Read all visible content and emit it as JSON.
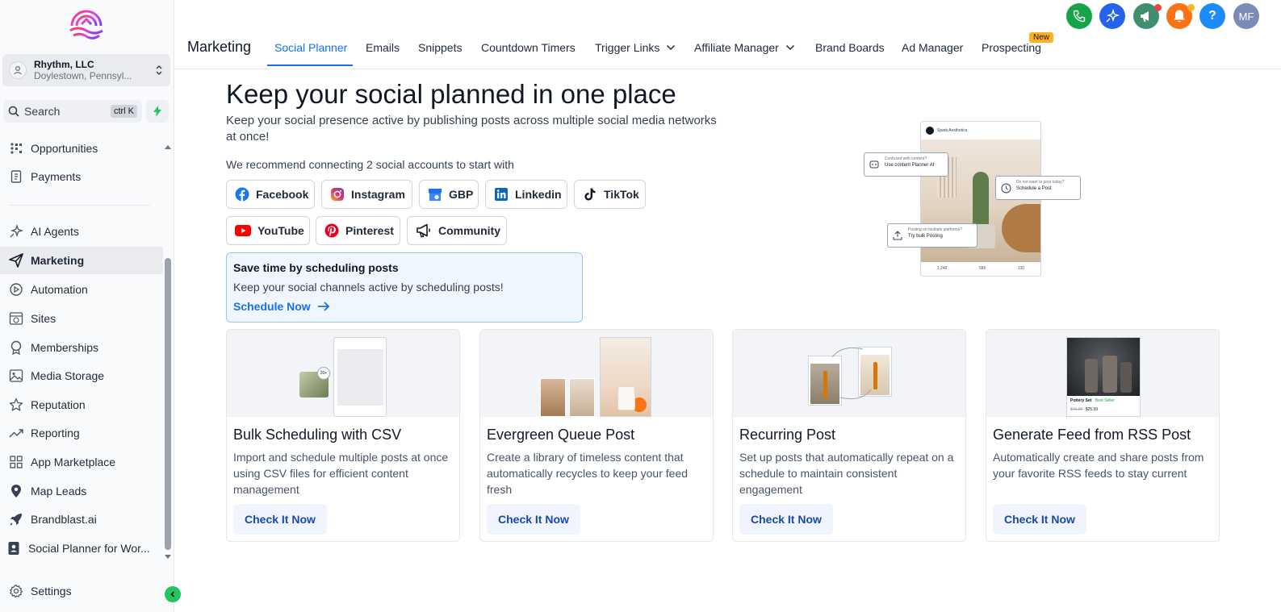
{
  "colors": {
    "accent": "#1570ef",
    "new_badge": "#fdb022",
    "collapse": "#22c55e"
  },
  "sidebar": {
    "account": {
      "name": "Rhythm, LLC",
      "location": "Doylestown, Pennsyl..."
    },
    "search": {
      "label": "Search",
      "shortcut": "ctrl K"
    },
    "items": [
      {
        "label": "Opportunities",
        "icon": "opportunities-icon"
      },
      {
        "label": "Payments",
        "icon": "payments-icon"
      },
      {
        "label": "AI Agents",
        "icon": "sparkle-icon"
      },
      {
        "label": "Marketing",
        "icon": "send-icon"
      },
      {
        "label": "Automation",
        "icon": "automation-icon"
      },
      {
        "label": "Sites",
        "icon": "globe-icon"
      },
      {
        "label": "Memberships",
        "icon": "badge-icon"
      },
      {
        "label": "Media Storage",
        "icon": "image-icon"
      },
      {
        "label": "Reputation",
        "icon": "star-icon"
      },
      {
        "label": "Reporting",
        "icon": "trend-icon"
      },
      {
        "label": "App Marketplace",
        "icon": "grid-icon"
      },
      {
        "label": "Map Leads",
        "icon": "pin-icon"
      },
      {
        "label": "Brandblast.ai",
        "icon": "rocket-icon"
      },
      {
        "label": "Social Planner for Wor...",
        "icon": "contact-icon"
      },
      {
        "label": "Settings",
        "icon": "gear-icon"
      }
    ]
  },
  "topnav": {
    "title": "Marketing",
    "tabs": [
      {
        "label": "Social Planner"
      },
      {
        "label": "Emails"
      },
      {
        "label": "Snippets"
      },
      {
        "label": "Countdown Timers"
      },
      {
        "label": "Trigger Links"
      },
      {
        "label": "Affiliate Manager"
      },
      {
        "label": "Brand Boards"
      },
      {
        "label": "Ad Manager"
      },
      {
        "label": "Prospecting"
      }
    ],
    "new_badge": "New",
    "user_initials": "MF",
    "help": "?"
  },
  "hero": {
    "title": "Keep your social planned in one place",
    "subtitle": "Keep your social presence active by publishing posts across multiple social media networks at once!",
    "recommend": "We recommend connecting 2 social accounts to start with"
  },
  "social": [
    "Facebook",
    "Instagram",
    "GBP",
    "Linkedin",
    "TikTok",
    "YouTube",
    "Pinterest",
    "Community"
  ],
  "tip": {
    "title": "Save time by scheduling posts",
    "body": "Keep your social channels active by scheduling posts!",
    "cta": "Schedule Now"
  },
  "preview": {
    "brand": "Spark Aesthetics",
    "bubble1_small": "Confused with content?",
    "bubble1_main": "Use content Planner AI",
    "bubble2_small": "Do not want to post today?",
    "bubble2_main": "Schedule a Post",
    "bubble3_small": "Posting on multiple platforms?",
    "bubble3_main": "Try bulk Posting",
    "likes": "1,246",
    "comments": "586",
    "shares": "120"
  },
  "cards": [
    {
      "title": "Bulk Scheduling with CSV",
      "desc": "Import and schedule multiple posts at once using CSV files for efficient content management",
      "cta": "Check It Now"
    },
    {
      "title": "Evergreen Queue Post",
      "desc": "Create a library of timeless content that automatically recycles to keep your feed fresh",
      "cta": "Check It Now"
    },
    {
      "title": "Recurring Post",
      "desc": "Set up posts that automatically repeat on a schedule to maintain consistent engagement",
      "cta": "Check It Now"
    },
    {
      "title": "Generate Feed from RSS Post",
      "desc": "Automatically create and share posts from your favorite RSS feeds to stay current",
      "cta": "Check It Now"
    }
  ],
  "card_art": {
    "bulk_badge": "20+",
    "rss_product": "Pottery Set",
    "rss_badge": "Best Seller",
    "rss_old_price": "$49.99",
    "rss_price": "$25.99"
  }
}
